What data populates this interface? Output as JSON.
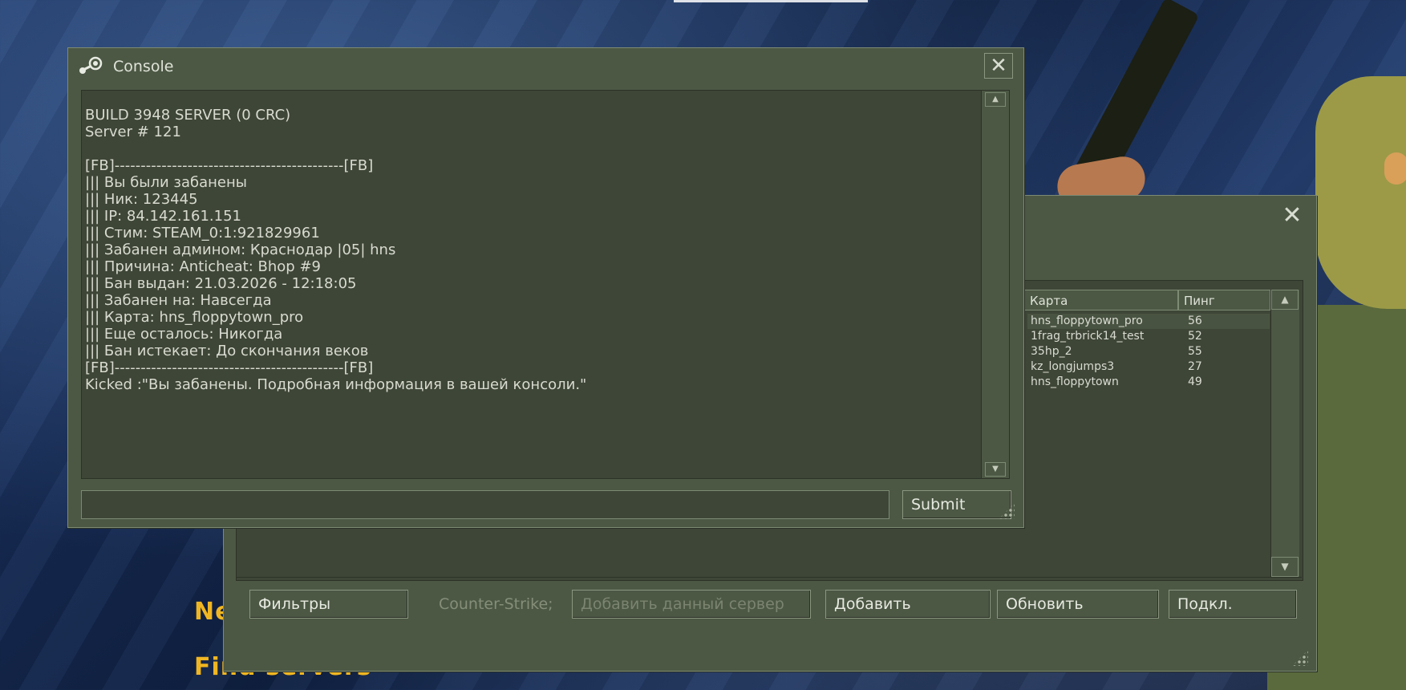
{
  "console": {
    "title": "Console",
    "lines": [
      "BUILD 3948 SERVER (0 CRC)",
      "Server # 121",
      "",
      "[FB]--------------------------------------------[FB]",
      "||| Вы были забанены",
      "||| Ник: 123445",
      "||| IP: 84.142.161.151",
      "||| Стим: STEAM_0:1:921829961",
      "||| Забанен админом: Краснодар |05| hns",
      "||| Причина: Anticheat: Bhop #9",
      "||| Бан выдан: 21.03.2026 - 12:18:05",
      "||| Забанен на: Навсегда",
      "||| Карта: hns_floppytown_pro",
      "||| Еще осталось: Никогда",
      "||| Бан истекает: До скончания веков",
      "[FB]--------------------------------------------[FB]",
      "Kicked :\"Вы забанены. Подробная информация в вашей консоли.\""
    ],
    "input_value": "",
    "submit_label": "Submit"
  },
  "browser": {
    "columns": {
      "map": "Карта",
      "ping": "Пинг"
    },
    "servers": [
      {
        "map": "hns_floppytown_pro",
        "ping": "56"
      },
      {
        "map": "1frag_trbrick14_test",
        "ping": "52"
      },
      {
        "map": "35hp_2",
        "ping": "55"
      },
      {
        "map": "kz_longjumps3",
        "ping": "27"
      },
      {
        "map": "hns_floppytown",
        "ping": "49"
      }
    ],
    "filters_label": "Фильтры",
    "game_label": "Counter-Strike;",
    "add_current_label": "Добавить данный сервер",
    "add_label": "Добавить",
    "refresh_label": "Обновить",
    "connect_label": "Подкл."
  },
  "menu": {
    "item_partial": "Ne",
    "find_servers": "Find servers"
  },
  "colors": {
    "window_bg": "#4c5844",
    "panel_bg": "#3e4637",
    "menu_text": "#f0b622"
  }
}
